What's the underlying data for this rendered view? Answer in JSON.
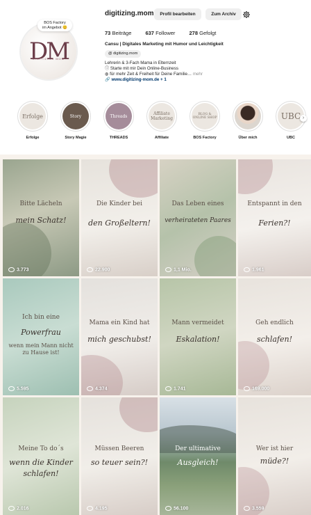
{
  "profile": {
    "username": "digitizing.mom",
    "edit_label": "Profil bearbeiten",
    "archive_label": "Zum Archiv",
    "posts_count": "73",
    "posts_label": "Beiträge",
    "followers_count": "637",
    "followers_label": "Follower",
    "following_count": "278",
    "following_label": "Gefolgt",
    "name": "Cansu | Digitales Marketing mit Humor und Leichtigkeit",
    "threads_handle": "digitizing.mom",
    "bio_line1": "Lehrerin & 3-Fach Mama in Elternzeit",
    "bio_line2": "Starte mit mir Dein Online-Business",
    "bio_line3": "für mehr Zeit & Freiheit für Deine Familie…",
    "bio_more": "mehr",
    "link": "www.digitizing-mom.de + 1",
    "avatar_logo": "DM",
    "avatar_sub": "DIGITIZING MOM",
    "note_line1": "BOS Factory",
    "note_line2": "im Angebot 😊"
  },
  "highlights": [
    {
      "label": "Erfolge",
      "cover": "Erfolge"
    },
    {
      "label": "Story Magie",
      "cover": "Story"
    },
    {
      "label": "THREADS",
      "cover": "Threads"
    },
    {
      "label": "Affiliate",
      "cover": "Affiliate Marketing"
    },
    {
      "label": "BOS Factory",
      "cover": "BLOG & ONLINE SHOP"
    },
    {
      "label": "Über mich",
      "cover": ""
    },
    {
      "label": "UBC",
      "cover": "UBC"
    }
  ],
  "posts": [
    {
      "line1": "Bitte Lächeln",
      "line2": "mein Schatz!",
      "views": "3.773"
    },
    {
      "line1": "Die Kinder bei",
      "line2": "den Großeltern!",
      "views": "22.900"
    },
    {
      "line1": "Das Leben eines",
      "line2": "verheirateten Paares",
      "views": "1,1 Mio."
    },
    {
      "line1": "Entspannt in den",
      "line2": "Ferien?!",
      "views": "1.961"
    },
    {
      "line1": "Ich bin eine",
      "line2": "Powerfrau",
      "line3": "wenn mein Mann nicht zu Hause ist!",
      "views": "5.595"
    },
    {
      "line1": "Mama ein Kind hat",
      "line2": "mich geschubst!",
      "views": "4.374"
    },
    {
      "line1": "Mann vermeidet",
      "line2": "Eskalation!",
      "views": "1.741"
    },
    {
      "line1": "Geh endlich",
      "line2": "schlafen!",
      "views": "169.000"
    },
    {
      "line1": "Meine To do´s",
      "line2": "wenn die Kinder schlafen!",
      "views": "2.016"
    },
    {
      "line1": "Müssen Beeren",
      "line2": "so teuer sein?!",
      "views": "4.195"
    },
    {
      "line1": "Der ultimative",
      "line2": "Ausgleich!",
      "views": "56.100"
    },
    {
      "line1": "Wer ist hier",
      "line2": "müde?!",
      "views": "3.559"
    }
  ]
}
